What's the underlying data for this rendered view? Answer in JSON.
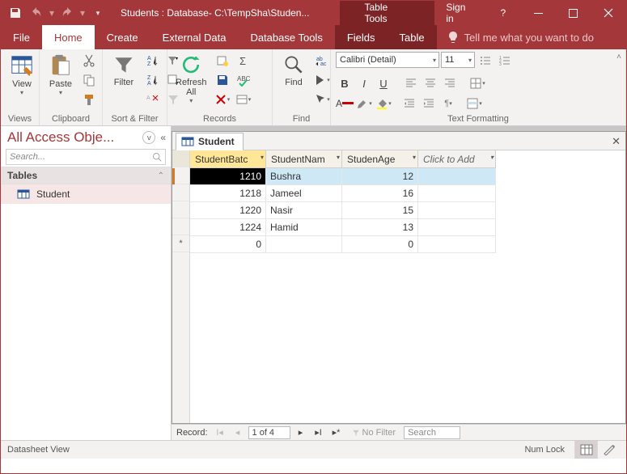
{
  "titlebar": {
    "title": "Students : Database- C:\\TempSha\\Studen...",
    "contextual_label": "Table Tools",
    "signin": "Sign in"
  },
  "tabs": {
    "file": "File",
    "home": "Home",
    "create": "Create",
    "external": "External Data",
    "dbtools": "Database Tools",
    "fields": "Fields",
    "table": "Table",
    "tellme": "Tell me what you want to do"
  },
  "ribbon": {
    "view": "View",
    "paste": "Paste",
    "filter": "Filter",
    "refresh": "Refresh\nAll",
    "find": "Find",
    "font_name": "Calibri (Detail)",
    "font_size": "11",
    "groups": {
      "views": "Views",
      "clipboard": "Clipboard",
      "sortfilter": "Sort & Filter",
      "records": "Records",
      "find": "Find",
      "textfmt": "Text Formatting"
    }
  },
  "nav": {
    "header": "All Access Obje...",
    "search_placeholder": "Search...",
    "group_tables": "Tables",
    "item_student": "Student"
  },
  "doc": {
    "tab": "Student",
    "cols": {
      "c1": "StudentBatc",
      "c2": "StudentNam",
      "c3": "StudenAge",
      "c4": "Click to Add"
    },
    "rows": [
      {
        "batch": "1210",
        "name": "Bushra",
        "age": "12"
      },
      {
        "batch": "1218",
        "name": "Jameel",
        "age": "16"
      },
      {
        "batch": "1220",
        "name": "Nasir",
        "age": "15"
      },
      {
        "batch": "1224",
        "name": "Hamid",
        "age": "13"
      }
    ],
    "newrow": {
      "batch": "0",
      "age": "0"
    }
  },
  "recnav": {
    "label": "Record:",
    "pos": "1 of 4",
    "nofilter": "No Filter",
    "search": "Search"
  },
  "status": {
    "left": "Datasheet View",
    "numlock": "Num Lock"
  }
}
